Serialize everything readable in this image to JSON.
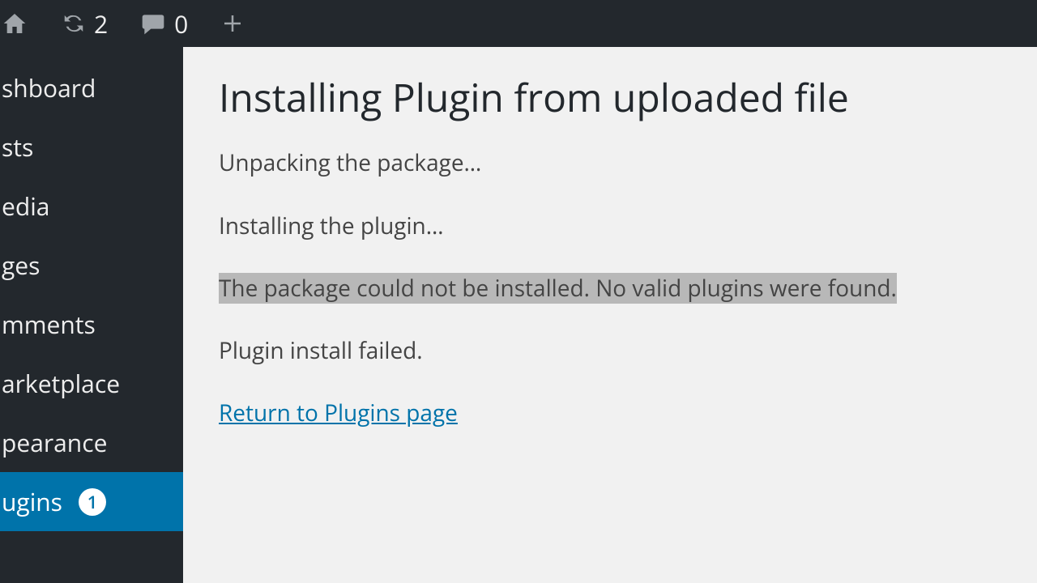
{
  "adminbar": {
    "updates_count": "2",
    "comments_count": "0"
  },
  "sidebar": {
    "items": [
      {
        "label": "shboard"
      },
      {
        "label": "sts"
      },
      {
        "label": "edia"
      },
      {
        "label": "ges"
      },
      {
        "label": "mments"
      },
      {
        "label": "arketplace"
      },
      {
        "label": "pearance"
      },
      {
        "label": "ugins",
        "badge": "1"
      }
    ]
  },
  "main": {
    "title": "Installing Plugin from uploaded file",
    "lines": {
      "unpacking": "Unpacking the package…",
      "installing": "Installing the plugin…",
      "error": "The package could not be installed. No valid plugins were found.",
      "failed": "Plugin install failed.",
      "return_link": "Return to Plugins page"
    }
  }
}
